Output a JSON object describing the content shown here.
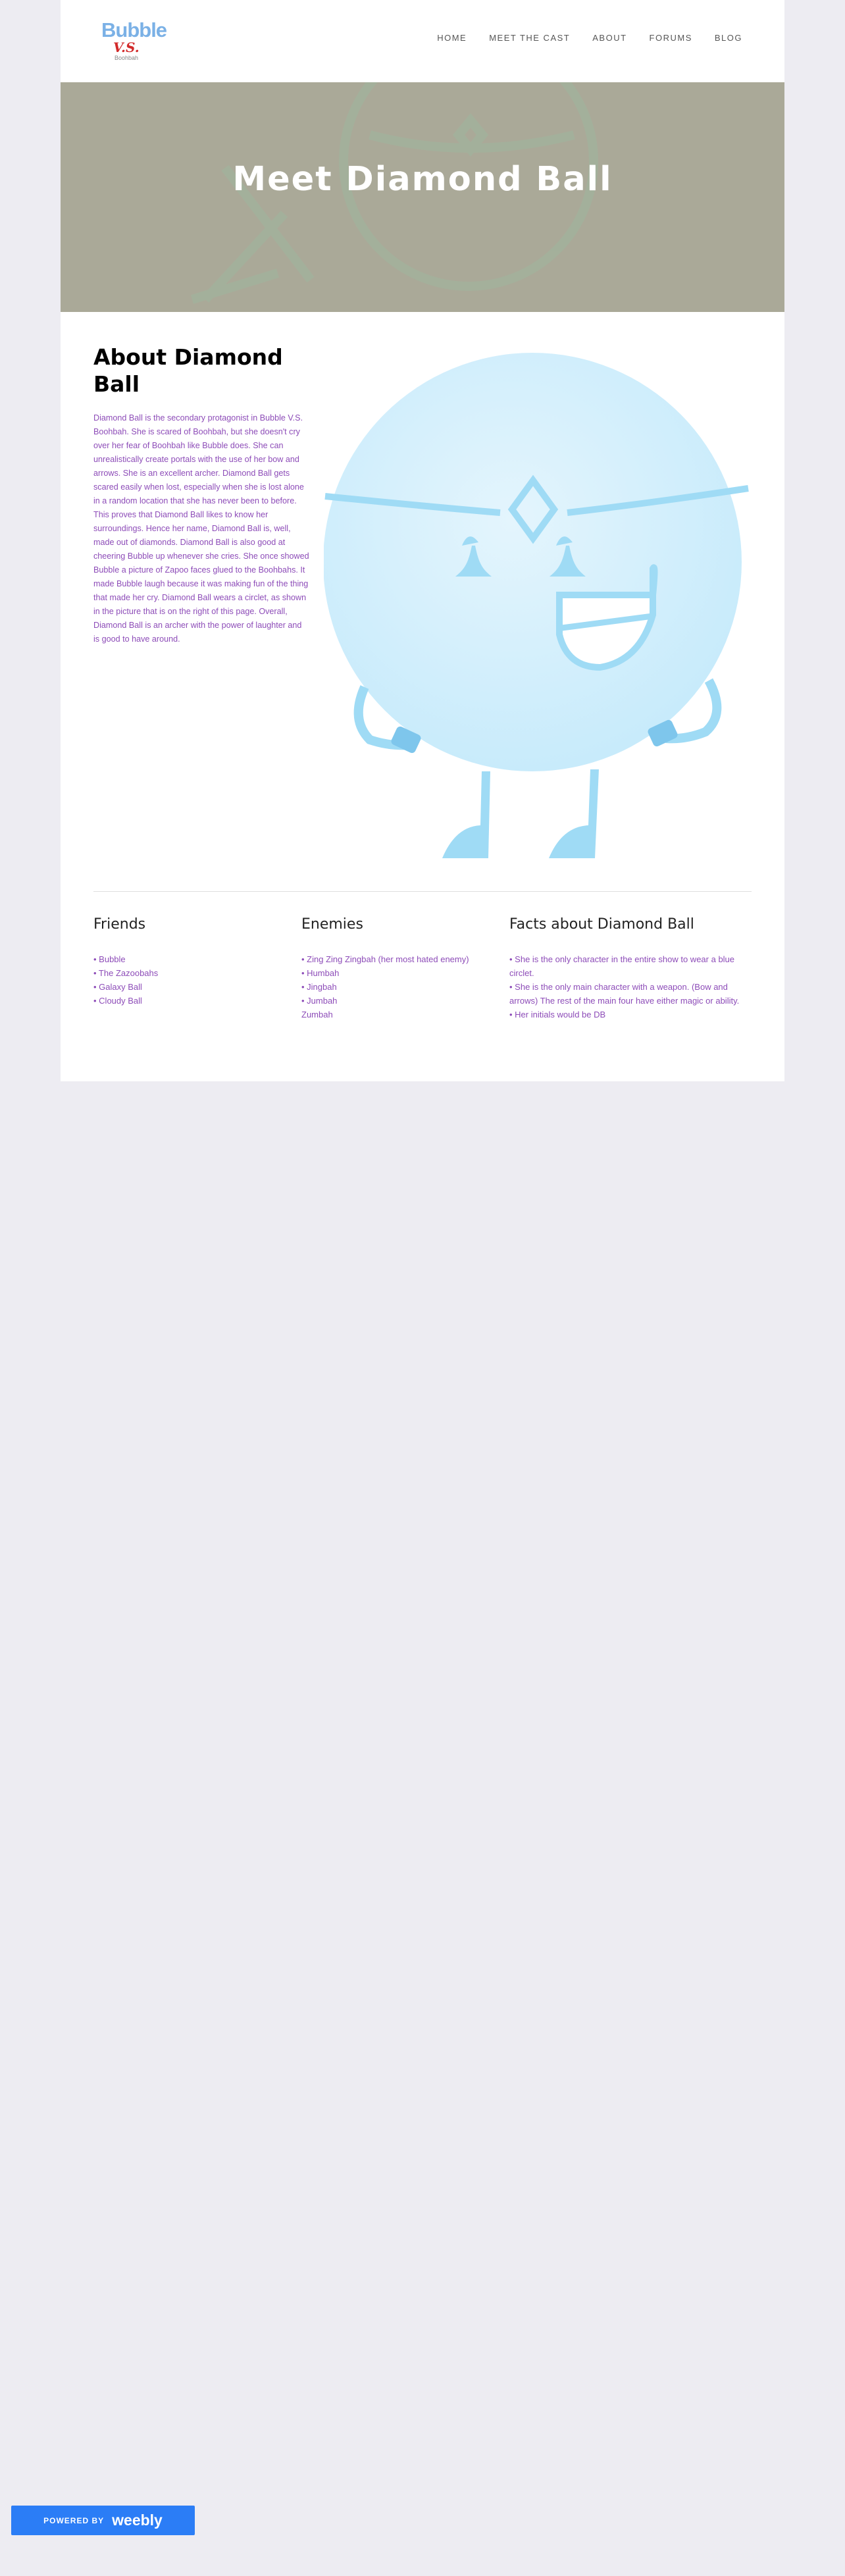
{
  "header": {
    "logo": {
      "line1": "Bubble",
      "line2": "V.S.",
      "line3": "Boohbah"
    },
    "nav": [
      "HOME",
      "MEET THE CAST",
      "ABOUT",
      "FORUMS",
      "BLOG"
    ]
  },
  "banner": {
    "title": "Meet Diamond Ball"
  },
  "about": {
    "title": "About Diamond Ball",
    "text": "Diamond Ball is the secondary protagonist in Bubble V.S. Boohbah.  She is scared of Boohbah, but she doesn't cry over her fear of Boohbah like Bubble does. She can unrealistically create portals with the use of her bow and arrows. She is an excellent archer. Diamond Ball gets scared easily when lost, especially when she is lost alone in a random location that she has never been to before.  This proves that Diamond Ball likes to know her surroundings. Hence her name, Diamond Ball is, well, made out of diamonds. Diamond Ball is also good at cheering Bubble up whenever she cries. She once showed Bubble a picture of Zapoo faces glued to the Boohbahs. It made Bubble laugh because it was making fun of the thing that made her cry. Diamond Ball wears a circlet, as shown in the picture that is on the right of this page. Overall, Diamond Ball is an archer with the power of laughter and is good to have around."
  },
  "friends": {
    "title": "Friends",
    "items": [
      "• Bubble",
      "• The Zazoobahs",
      "• Galaxy Ball",
      "• Cloudy Ball"
    ]
  },
  "enemies": {
    "title": "Enemies",
    "items": [
      "• Zing Zing Zingbah (her most hated enemy)",
      "• Humbah",
      "• Jingbah",
      "• Jumbah",
      "Zumbah"
    ]
  },
  "facts": {
    "title": "Facts about Diamond Ball",
    "items": [
      "• She is the only character in the entire show to wear a blue circlet.",
      "• She is the only main character with a weapon. (Bow and arrows) The rest of the main four have either magic or ability.",
      "• Her initials would be DB"
    ]
  },
  "footer": {
    "powered_by": "POWERED BY",
    "brand": "weebly"
  },
  "colors": {
    "link_purple": "#8d4cb8",
    "banner_bg": "#aaa998",
    "character_blue": "#9fdbf5",
    "weebly_blue": "#2b7df6"
  }
}
